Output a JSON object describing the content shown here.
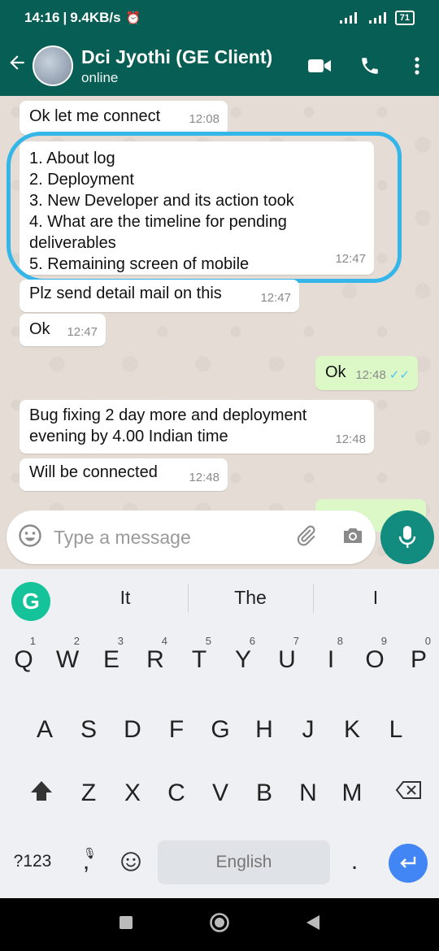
{
  "status_bar": {
    "time": "14:16",
    "speed": "9.4KB/s",
    "battery": "71"
  },
  "header": {
    "contact_name": "Dci Jyothi (GE Client)",
    "status": "online"
  },
  "messages": [
    {
      "text": "Ok let me connect",
      "time": "12:08",
      "direction": "in"
    },
    {
      "lines": [
        "1. About log",
        "2. Deployment",
        "3. New Developer and its action took",
        "4. What are the timeline for pending",
        "deliverables",
        "5. Remaining screen of mobile"
      ],
      "time": "12:47",
      "direction": "in"
    },
    {
      "text": "Plz send detail mail on this",
      "time": "12:47",
      "direction": "in"
    },
    {
      "text": "Ok",
      "time": "12:47",
      "direction": "in"
    },
    {
      "text": "Ok",
      "time": "12:48",
      "direction": "out",
      "status": "read"
    },
    {
      "lines": [
        "Bug fixing 2 day more and deployment",
        "evening by 4.00 Indian time"
      ],
      "time": "12:48",
      "direction": "in"
    },
    {
      "text": "Will be connected",
      "time": "12:48",
      "direction": "in"
    }
  ],
  "composer": {
    "placeholder": "Type a message"
  },
  "keyboard": {
    "suggestions": [
      "It",
      "The",
      "I"
    ],
    "row1": [
      "Q",
      "W",
      "E",
      "R",
      "T",
      "Y",
      "U",
      "I",
      "O",
      "P"
    ],
    "row1_nums": [
      "1",
      "2",
      "3",
      "4",
      "5",
      "6",
      "7",
      "8",
      "9",
      "0"
    ],
    "row2": [
      "A",
      "S",
      "D",
      "F",
      "G",
      "H",
      "J",
      "K",
      "L"
    ],
    "row3": [
      "Z",
      "X",
      "C",
      "V",
      "B",
      "N",
      "M"
    ],
    "symbols_label": "?123",
    "comma": ",",
    "period": ".",
    "space_label": "English"
  },
  "colors": {
    "header": "#075e54",
    "accent": "#128c7e",
    "out_bubble": "#dcf8c6",
    "highlight": "#35b6e8",
    "read_ticks": "#4fc3f7"
  }
}
